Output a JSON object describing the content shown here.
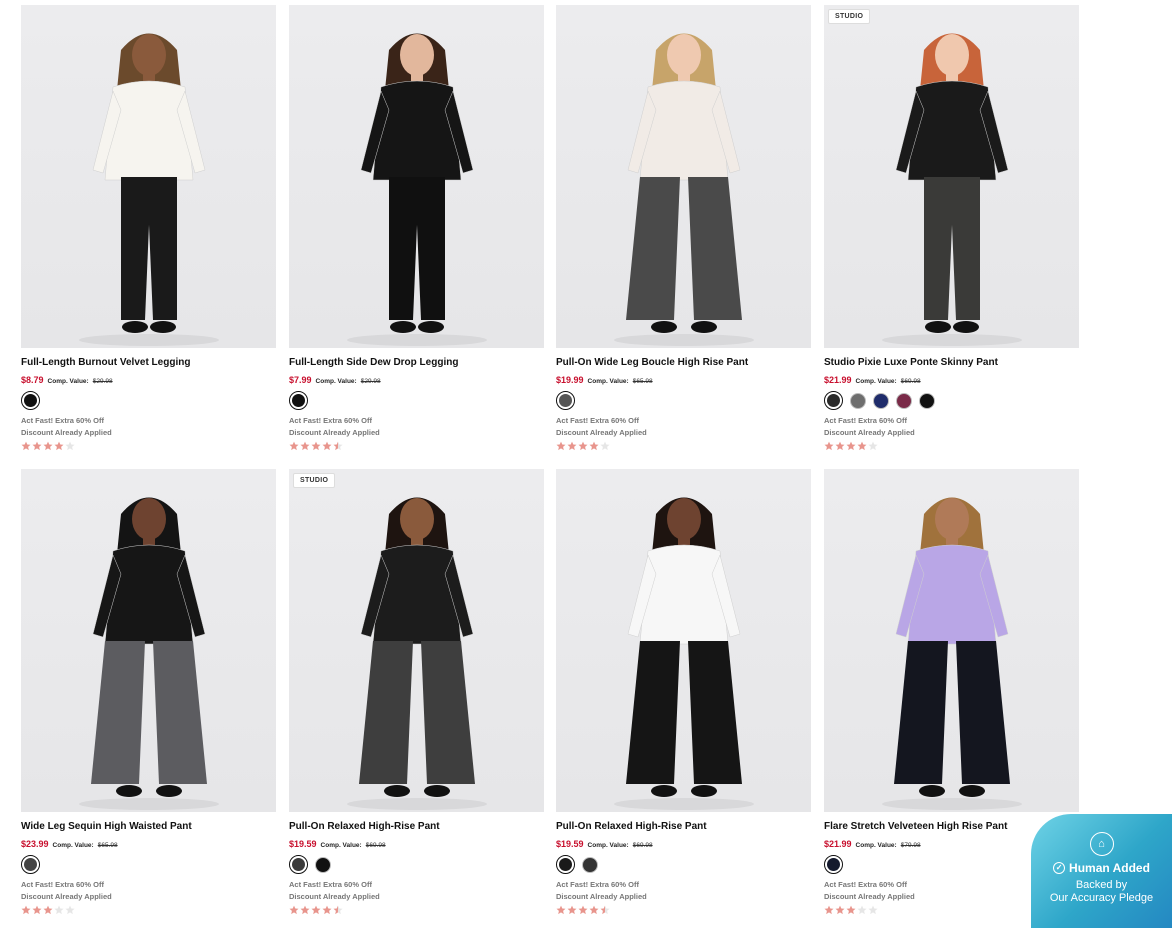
{
  "products": [
    {
      "title": "Full-Length Burnout Velvet Legging",
      "price": "$8.79",
      "comp_label": "Comp. Value:",
      "comp_value": "$29.98",
      "badge": "",
      "promo1": "Act Fast! Extra 60% Off",
      "promo2": "Discount Already Applied",
      "rating": 4.0,
      "swatches": [
        "#111111"
      ],
      "top_color": "#f6f4ef",
      "bottom_color": "#1a1a1a",
      "hair_color": "#6b4a2c",
      "skin": "#8a5a3c"
    },
    {
      "title": "Full-Length Side Dew Drop Legging",
      "price": "$7.99",
      "comp_label": "Comp. Value:",
      "comp_value": "$29.98",
      "badge": "",
      "promo1": "Act Fast! Extra 60% Off",
      "promo2": "Discount Already Applied",
      "rating": 4.5,
      "swatches": [
        "#111111"
      ],
      "top_color": "#151515",
      "bottom_color": "#101010",
      "hair_color": "#3a2418",
      "skin": "#e2b79c"
    },
    {
      "title": "Pull-On Wide Leg Boucle High Rise Pant",
      "price": "$19.99",
      "comp_label": "Comp. Value:",
      "comp_value": "$65.98",
      "badge": "",
      "promo1": "Act Fast! Extra 60% Off",
      "promo2": "Discount Already Applied",
      "rating": 4.0,
      "swatches": [
        "#555555"
      ],
      "top_color": "#f1ebe6",
      "bottom_color": "#4a4a4a",
      "hair_color": "#c7a46a",
      "skin": "#efc9b0"
    },
    {
      "title": "Studio Pixie Luxe Ponte Skinny Pant",
      "price": "$21.99",
      "comp_label": "Comp. Value:",
      "comp_value": "$69.98",
      "badge": "STUDIO",
      "promo1": "Act Fast! Extra 60% Off",
      "promo2": "Discount Already Applied",
      "rating": 4.0,
      "swatches": [
        "#2b2b2b",
        "#6e6e6e",
        "#1f2c6b",
        "#7a2a48",
        "#111111"
      ],
      "top_color": "#1a1a1a",
      "bottom_color": "#3a3a38",
      "hair_color": "#c8643a",
      "skin": "#f0c8ae"
    },
    {
      "title": "Wide Leg Sequin High Waisted Pant",
      "price": "$23.99",
      "comp_label": "Comp. Value:",
      "comp_value": "$65.98",
      "badge": "",
      "promo1": "Act Fast! Extra 60% Off",
      "promo2": "Discount Already Applied",
      "rating": 3.0,
      "swatches": [
        "#444444"
      ],
      "top_color": "#161616",
      "bottom_color": "#5c5c60",
      "hair_color": "#141414",
      "skin": "#6e4330"
    },
    {
      "title": "Pull-On Relaxed High-Rise Pant",
      "price": "$19.59",
      "comp_label": "Comp. Value:",
      "comp_value": "$69.98",
      "badge": "STUDIO",
      "promo1": "Act Fast! Extra 60% Off",
      "promo2": "Discount Already Applied",
      "rating": 4.5,
      "swatches": [
        "#3a3a3a",
        "#111111"
      ],
      "top_color": "#1c1c1c",
      "bottom_color": "#3e3e3e",
      "hair_color": "#1e1410",
      "skin": "#8a5a3c"
    },
    {
      "title": "Pull-On Relaxed High-Rise Pant",
      "price": "$19.59",
      "comp_label": "Comp. Value:",
      "comp_value": "$69.98",
      "badge": "",
      "promo1": "Act Fast! Extra 60% Off",
      "promo2": "Discount Already Applied",
      "rating": 4.5,
      "swatches": [
        "#1a1a1a",
        "#333333"
      ],
      "top_color": "#f7f7f7",
      "bottom_color": "#151515",
      "hair_color": "#1e1410",
      "skin": "#6e4330"
    },
    {
      "title": "Flare Stretch Velveteen High Rise Pant",
      "price": "$21.99",
      "comp_label": "Comp. Value:",
      "comp_value": "$79.98",
      "badge": "",
      "promo1": "Act Fast! Extra 60% Off",
      "promo2": "Discount Already Applied",
      "rating": 3.0,
      "swatches": [
        "#141a2e"
      ],
      "top_color": "#b9a6e6",
      "bottom_color": "#14161f",
      "hair_color": "#a0723c",
      "skin": "#b07a58"
    }
  ],
  "colors": {
    "price_red": "#c8103e",
    "star_filled": "#e8958d",
    "star_empty": "#e6e6e6"
  },
  "pledge": {
    "icon": "house-shield-icon",
    "line1": "Human Added",
    "line2": "Backed by",
    "line3": "Our Accuracy Pledge"
  }
}
